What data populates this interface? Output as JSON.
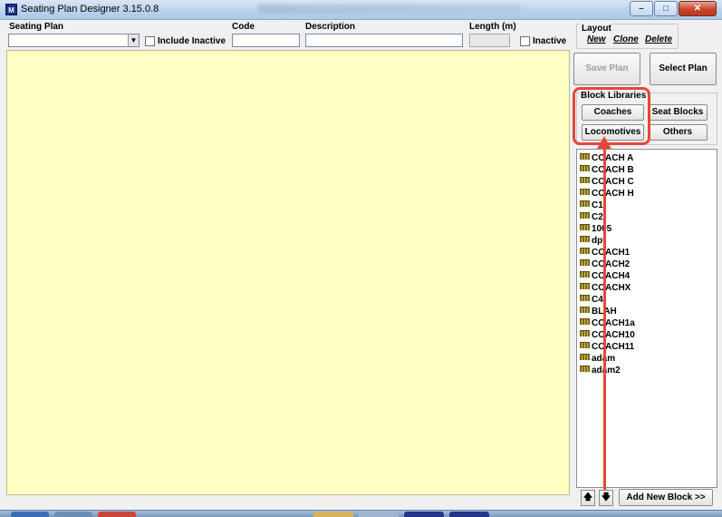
{
  "window": {
    "title": "Seating Plan Designer  3.15.0.8",
    "icon_text": "M",
    "buttons": {
      "minimize": "–",
      "maximize": "□",
      "close": "✕"
    }
  },
  "filters": {
    "seating_plan_label": "Seating Plan",
    "seating_plan_value": "",
    "include_inactive_label": "Include Inactive",
    "code_label": "Code",
    "code_value": "",
    "description_label": "Description",
    "description_value": "",
    "length_label": "Length (m)",
    "length_value": "",
    "inactive_label": "Inactive"
  },
  "layout": {
    "legend": "Layout",
    "new_label": "New",
    "clone_label": "Clone",
    "delete_label": "Delete"
  },
  "plan_buttons": {
    "save_label": "Save Plan",
    "select_label": "Select Plan"
  },
  "block_libraries": {
    "legend": "Block Libraries",
    "coaches_label": "Coaches",
    "seat_blocks_label": "Seat Blocks",
    "locomotives_label": "Locomotives",
    "others_label": "Others"
  },
  "blocks": [
    "COACH A",
    "COACH B",
    "COACH C",
    "COACH H",
    "C1",
    "C2",
    "1005",
    "dpt",
    "COACH1",
    "COACH2",
    "COACH4",
    "COACHX",
    "C4",
    "BLAH",
    "COACH1a",
    "COACH10",
    "COACH11",
    "adam",
    "adam2"
  ],
  "bottom": {
    "move_up_symbol": "🠅",
    "move_down_symbol": "🠇",
    "add_block_label": "Add New Block >>"
  },
  "colors": {
    "canvas": "#ffffc1",
    "annotation": "#e4483a"
  },
  "icons": {
    "block_item": "coach-block-icon",
    "app": "app-logo-icon"
  }
}
